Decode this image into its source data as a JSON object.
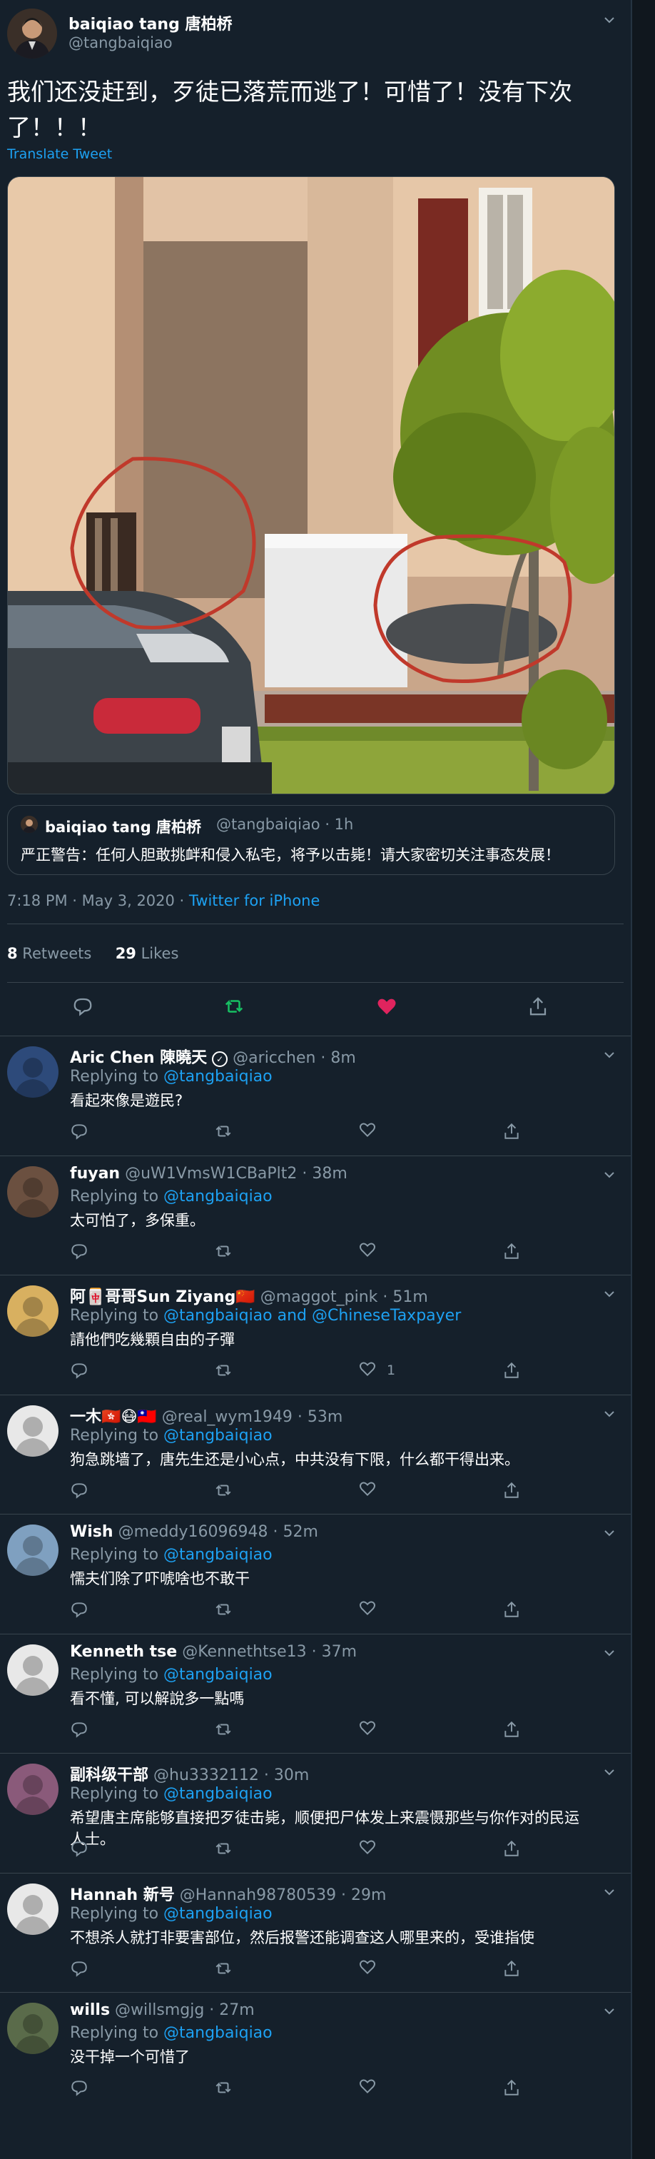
{
  "tweet": {
    "author_name": "baiqiao tang 唐柏桥",
    "author_handle": "@tangbaiqiao",
    "text": "我们还没赶到，歹徒已落荒而逃了！可惜了！没有下次了！！！",
    "translate_label": "Translate Tweet",
    "timestamp": "7:18 PM · May 3, 2020 · ",
    "via": "Twitter for iPhone",
    "retweets": "8",
    "retweets_label": " Retweets",
    "likes": "29",
    "likes_label": " Likes"
  },
  "quoted": {
    "author_name": "baiqiao tang 唐柏桥",
    "author_handle": "@tangbaiqiao · 1h",
    "text": "严正警告：任何人胆敢挑衅和侵入私宅，将予以击毙！请大家密切关注事态发展！"
  },
  "colors": {
    "background": "#15202b",
    "border": "#38444d",
    "secondary_text": "#8899a6",
    "link": "#1da1f2",
    "retweet_active": "#17bf63",
    "like_active": "#e0245e"
  },
  "replies": [
    {
      "name": "Aric Chen 陳曉天",
      "verified": true,
      "meta": "@aricchen · 8m",
      "replying": "Replying to ",
      "mentions": "@tangbaiqiao",
      "text": "看起來像是遊民?",
      "likes": ""
    },
    {
      "name": "fuyan",
      "meta": "@uW1VmsW1CBaPlt2 · 38m",
      "replying": "Replying to ",
      "mentions": "@tangbaiqiao",
      "text": "太可怕了，多保重。",
      "likes": ""
    },
    {
      "name": "阿🀄哥哥Sun Ziyang🇨🇳",
      "meta": "@maggot_pink · 51m",
      "replying": "Replying to ",
      "mentions": "@tangbaiqiao and @ChineseTaxpayer",
      "text": "請他們吃幾顆自由的子彈",
      "likes": "1"
    },
    {
      "name": "一木🇭🇰😷🇹🇼",
      "meta": "@real_wym1949 · 53m",
      "replying": "Replying to ",
      "mentions": "@tangbaiqiao",
      "text": "狗急跳墙了，唐先生还是小心点，中共没有下限，什么都干得出来。",
      "likes": ""
    },
    {
      "name": "Wish",
      "meta": "@meddy16096948 · 52m",
      "replying": "Replying to ",
      "mentions": "@tangbaiqiao",
      "text": "懦夫们除了吓唬啥也不敢干",
      "likes": ""
    },
    {
      "name": "Kenneth tse",
      "meta": "@Kennethtse13 · 37m",
      "replying": "Replying to ",
      "mentions": "@tangbaiqiao",
      "text": "看不懂, 可以解說多一點嗎",
      "likes": ""
    },
    {
      "name": "副科级干部",
      "meta": "@hu3332112 · 30m",
      "replying": "Replying to ",
      "mentions": "@tangbaiqiao",
      "text": "希望唐主席能够直接把歹徒击毙，顺便把尸体发上来震慑那些与你作对的民运人士。",
      "likes": ""
    },
    {
      "name": "Hannah 新号",
      "meta": "@Hannah98780539 · 29m",
      "replying": "Replying to ",
      "mentions": "@tangbaiqiao",
      "text": "不想杀人就打非要害部位，然后报警还能调查这人哪里来的，受谁指使",
      "likes": ""
    },
    {
      "name": "wills",
      "meta": "@willsmgjg · 27m",
      "replying": "Replying to ",
      "mentions": "@tangbaiqiao",
      "text": "没干掉一个可惜了",
      "likes": ""
    }
  ]
}
